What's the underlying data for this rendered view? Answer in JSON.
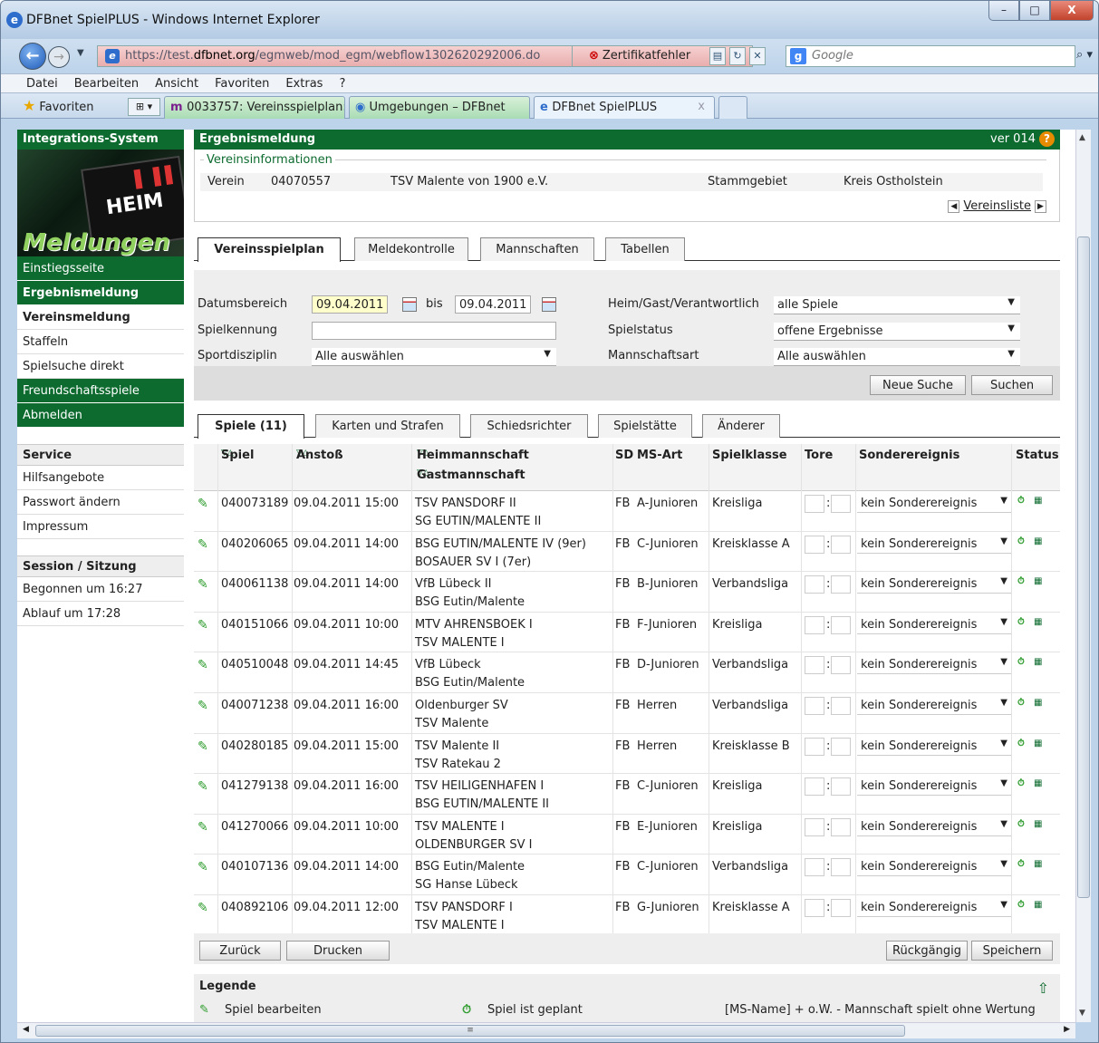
{
  "window": {
    "title": "DFBnet SpielPLUS - Windows Internet Explorer",
    "min": "–",
    "max": "□",
    "close": "X"
  },
  "browser": {
    "url_prefix": "https://test.",
    "url_domain": "dfbnet.org",
    "url_path": "/egmweb/mod_egm/webflow1302620292006.do",
    "cert_error": "Zertifikatfehler",
    "search_placeholder": "Google",
    "menu": [
      "Datei",
      "Bearbeiten",
      "Ansicht",
      "Favoriten",
      "Extras",
      "?"
    ],
    "favorites": "Favoriten",
    "tabs": [
      {
        "label": "0033757: Vereinsspielplan: ..."
      },
      {
        "label": "Umgebungen – DFBnet"
      },
      {
        "label": "DFBnet SpielPLUS"
      }
    ]
  },
  "sidebar": {
    "header": "Integrations-System",
    "img_heim": "HEIM",
    "img_meldungen": "Meldungen",
    "items": [
      {
        "label": "Einstiegsseite"
      },
      {
        "label": "Ergebnismeldung"
      },
      {
        "label": "Vereinsmeldung"
      },
      {
        "label": "Staffeln"
      },
      {
        "label": "Spielsuche direkt"
      },
      {
        "label": "Freundschaftsspiele"
      },
      {
        "label": "Abmelden"
      }
    ],
    "service_title": "Service",
    "service_items": [
      {
        "label": "Hilfsangebote"
      },
      {
        "label": "Passwort ändern"
      },
      {
        "label": "Impressum"
      }
    ],
    "session_title": "Session / Sitzung",
    "session_start": "Begonnen um 16:27",
    "session_end": "Ablauf um 17:28"
  },
  "main": {
    "title": "Ergebnismeldung",
    "version": "ver 014",
    "help": "?",
    "vinfo": {
      "legend": "Vereinsinformationen",
      "verein_label": "Verein",
      "verein_nr": "04070557",
      "verein_name": "TSV Malente von 1900 e.V.",
      "stammgebiet_label": "Stammgebiet",
      "stammgebiet": "Kreis Ostholstein",
      "vereinsliste": "Vereinsliste"
    },
    "tabs1": [
      "Vereinsspielplan",
      "Meldekontrolle",
      "Mannschaften",
      "Tabellen"
    ],
    "filter": {
      "datum_label": "Datumsbereich",
      "datum_from": "09.04.2011",
      "bis": "bis",
      "datum_to": "09.04.2011",
      "kennung_label": "Spielkennung",
      "kennung": "",
      "sport_label": "Sportdisziplin",
      "sport": "Alle auswählen",
      "heim_label": "Heim/Gast/Verantwortlich",
      "heim": "alle Spiele",
      "status_label": "Spielstatus",
      "status": "offene Ergebnisse",
      "mart_label": "Mannschaftsart",
      "mart": "Alle auswählen",
      "neue_suche": "Neue Suche",
      "suchen": "Suchen"
    },
    "tabs2": [
      "Spiele (11)",
      "Karten und Strafen",
      "Schiedsrichter",
      "Spielstätte",
      "Änderer"
    ],
    "grid": {
      "headers": {
        "spiel": "Spiel",
        "anstoss": "Anstoß",
        "heim": "Heimmannschaft",
        "gast": "Gastmannschaft",
        "sd": "SD",
        "msart": "MS-Art",
        "klasse": "Spielklasse",
        "tore": "Tore",
        "sonder": "Sonderereignis",
        "status": "Status"
      },
      "rows": [
        {
          "spiel": "040073189",
          "anstoss": "09.04.2011 15:00",
          "heim": "TSV PANSDORF II",
          "gast": "SG EUTIN/MALENTE II",
          "sd": "FB",
          "msart": "A-Junioren",
          "klasse": "Kreisliga",
          "sonder": "kein Sonderereignis"
        },
        {
          "spiel": "040206065",
          "anstoss": "09.04.2011 14:00",
          "heim": "BSG EUTIN/MALENTE IV (9er)",
          "gast": "BOSAUER SV I (7er)",
          "sd": "FB",
          "msart": "C-Junioren",
          "klasse": "Kreisklasse A",
          "sonder": "kein Sonderereignis"
        },
        {
          "spiel": "040061138",
          "anstoss": "09.04.2011 14:00",
          "heim": "VfB Lübeck II",
          "gast": "BSG Eutin/Malente",
          "sd": "FB",
          "msart": "B-Junioren",
          "klasse": "Verbandsliga",
          "sonder": "kein Sonderereignis"
        },
        {
          "spiel": "040151066",
          "anstoss": "09.04.2011 10:00",
          "heim": "MTV AHRENSBOEK I",
          "gast": "TSV MALENTE I",
          "sd": "FB",
          "msart": "F-Junioren",
          "klasse": "Kreisliga",
          "sonder": "kein Sonderereignis"
        },
        {
          "spiel": "040510048",
          "anstoss": "09.04.2011 14:45",
          "heim": "VfB Lübeck",
          "gast": "BSG Eutin/Malente",
          "sd": "FB",
          "msart": "D-Junioren",
          "klasse": "Verbandsliga",
          "sonder": "kein Sonderereignis"
        },
        {
          "spiel": "040071238",
          "anstoss": "09.04.2011 16:00",
          "heim": "Oldenburger SV",
          "gast": "TSV Malente",
          "sd": "FB",
          "msart": "Herren",
          "klasse": "Verbandsliga",
          "sonder": "kein Sonderereignis"
        },
        {
          "spiel": "040280185",
          "anstoss": "09.04.2011 15:00",
          "heim": "TSV Malente II",
          "gast": "TSV Ratekau 2",
          "sd": "FB",
          "msart": "Herren",
          "klasse": "Kreisklasse B",
          "sonder": "kein Sonderereignis"
        },
        {
          "spiel": "041279138",
          "anstoss": "09.04.2011 16:00",
          "heim": "TSV HEILIGENHAFEN I",
          "gast": "BSG EUTIN/MALENTE II",
          "sd": "FB",
          "msart": "C-Junioren",
          "klasse": "Kreisliga",
          "sonder": "kein Sonderereignis"
        },
        {
          "spiel": "041270066",
          "anstoss": "09.04.2011 10:00",
          "heim": "TSV MALENTE I",
          "gast": "OLDENBURGER SV I",
          "sd": "FB",
          "msart": "E-Junioren",
          "klasse": "Kreisliga",
          "sonder": "kein Sonderereignis"
        },
        {
          "spiel": "040107136",
          "anstoss": "09.04.2011 14:00",
          "heim": "BSG Eutin/Malente",
          "gast": "SG Hanse Lübeck",
          "sd": "FB",
          "msart": "C-Junioren",
          "klasse": "Verbandsliga",
          "sonder": "kein Sonderereignis"
        },
        {
          "spiel": "040892106",
          "anstoss": "09.04.2011 12:00",
          "heim": "TSV PANSDORF I",
          "gast": "TSV MALENTE I",
          "sd": "FB",
          "msart": "G-Junioren",
          "klasse": "Kreisklasse A",
          "sonder": "kein Sonderereignis"
        }
      ]
    },
    "actions": {
      "zurueck": "Zurück",
      "drucken": "Drucken",
      "rueckgaengig": "Rückgängig",
      "speichern": "Speichern"
    },
    "legend": {
      "title": "Legende",
      "edit": "Spiel bearbeiten",
      "planned": "Spiel ist geplant",
      "note": "[MS-Name] + o.W. - Mannschaft spielt ohne Wertung"
    }
  },
  "colors": {
    "brand_green": "#0d6b2f",
    "highlight_yellow": "#ffffcc"
  }
}
